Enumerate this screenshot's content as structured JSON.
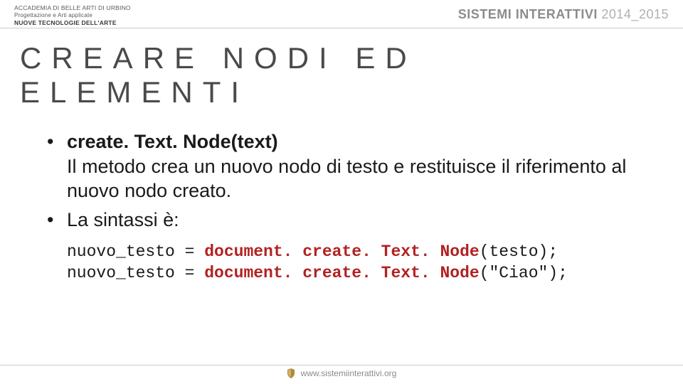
{
  "header": {
    "inst_line1": "ACCADEMIA DI BELLE ARTI DI URBINO",
    "inst_line2": "Progettazione e Arti applicate",
    "inst_line3": "NUOVE TECNOLOGIE DELL'ARTE",
    "course_name": "SISTEMI INTERATTIVI",
    "course_year": "2014_2015"
  },
  "title": "CREARE NODI ED ELEMENTI",
  "bullets": [
    {
      "method": "create. Text. Node(text)",
      "desc": "Il metodo crea un nuovo nodo di testo e restituisce il riferimento al nuovo nodo creato."
    },
    {
      "method": "",
      "desc": "La sintassi è:"
    }
  ],
  "code": {
    "line1_pre": "nuovo_testo = ",
    "line1_kw": "document. create. Text. Node",
    "line1_post": "(testo);",
    "line2_pre": "nuovo_testo = ",
    "line2_kw": "document. create. Text. Node",
    "line2_post": "(\"Ciao\");"
  },
  "footer": {
    "url": "www.sistemiinterattivi.org"
  }
}
